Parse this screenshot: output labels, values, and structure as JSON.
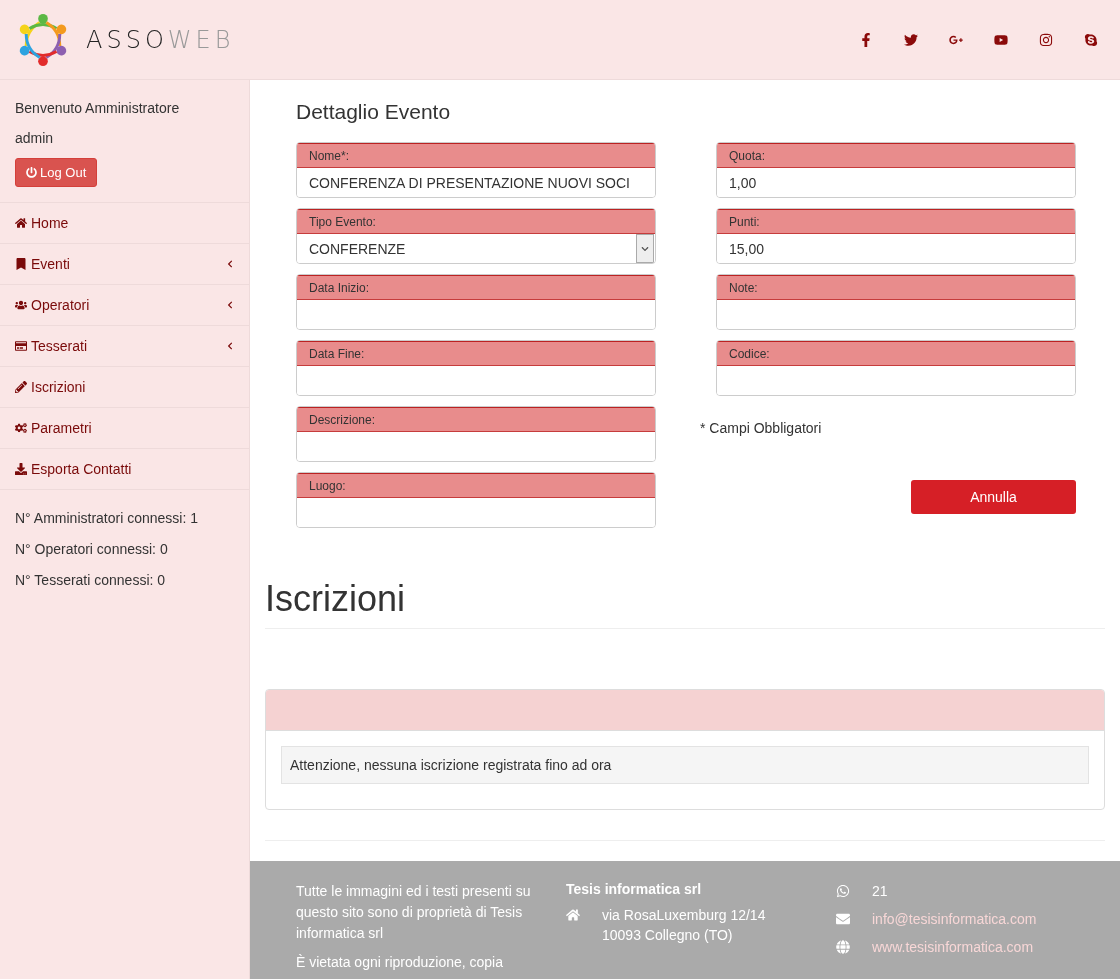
{
  "header": {
    "logo": {
      "part_1": "ASSO",
      "part_2": "WEB"
    },
    "social": [
      {
        "kind": "facebook"
      },
      {
        "kind": "twitter"
      },
      {
        "kind": "google-plus"
      },
      {
        "kind": "youtube"
      },
      {
        "kind": "instagram"
      },
      {
        "kind": "skype"
      }
    ]
  },
  "sidebar": {
    "welcome": "Benvenuto Amministratore",
    "user": "admin",
    "logout": "Log Out",
    "menu": [
      {
        "label": "Home",
        "kind": "home",
        "submenu": false
      },
      {
        "label": "Eventi",
        "kind": "bookmark",
        "submenu": true
      },
      {
        "label": "Operatori",
        "kind": "users",
        "submenu": true
      },
      {
        "label": "Tesserati",
        "kind": "card",
        "submenu": true
      },
      {
        "label": "Iscrizioni",
        "kind": "pencil",
        "submenu": false
      },
      {
        "label": "Parametri",
        "kind": "cogs",
        "submenu": false
      },
      {
        "label": "Esporta Contatti",
        "kind": "download",
        "submenu": false
      }
    ],
    "stats": [
      "N° Amministratori connessi: 1",
      "N° Operatori connessi: 0",
      "N° Tesserati connessi: 0"
    ]
  },
  "form": {
    "title": "Dettaglio Evento",
    "left_fields": [
      {
        "label": "Nome*:",
        "value": "CONFERENZA DI PRESENTAZIONE NUOVI SOCI",
        "kind": "text"
      },
      {
        "label": "Tipo Evento:",
        "value": "CONFERENZE",
        "kind": "select"
      },
      {
        "label": "Data Inizio:",
        "kind": "text"
      },
      {
        "label": "Data Fine:",
        "kind": "text"
      },
      {
        "label": "Descrizione:",
        "kind": "text"
      },
      {
        "label": "Luogo:",
        "kind": "text"
      }
    ],
    "right_fields": [
      {
        "label": "Quota:",
        "value": "1,00",
        "kind": "text"
      },
      {
        "label": "Punti:",
        "value": "15,00",
        "kind": "text"
      },
      {
        "label": "Note:",
        "kind": "text"
      },
      {
        "label": "Codice:",
        "kind": "text"
      }
    ],
    "note": "* Campi Obbligatori",
    "cancel": "Annulla"
  },
  "subscriptions": {
    "title": "Iscrizioni",
    "message": "Attenzione, nessuna iscrizione registrata fino ad ora"
  },
  "footer": {
    "disclaimer": [
      "Tutte le immagini ed i testi presenti su questo sito sono di proprietà di Tesis informatica srl",
      "È vietata ogni riproduzione, copia"
    ],
    "company": "Tesis informatica srl",
    "address": [
      "via RosaLuxemburg 12/14",
      "10093 Collegno (TO)"
    ],
    "contacts": [
      {
        "kind": "whatsapp",
        "text": "21"
      },
      {
        "kind": "email",
        "text": "info@tesisinformatica.com"
      },
      {
        "kind": "web",
        "text": "www.tesisinformatica.com"
      }
    ]
  }
}
